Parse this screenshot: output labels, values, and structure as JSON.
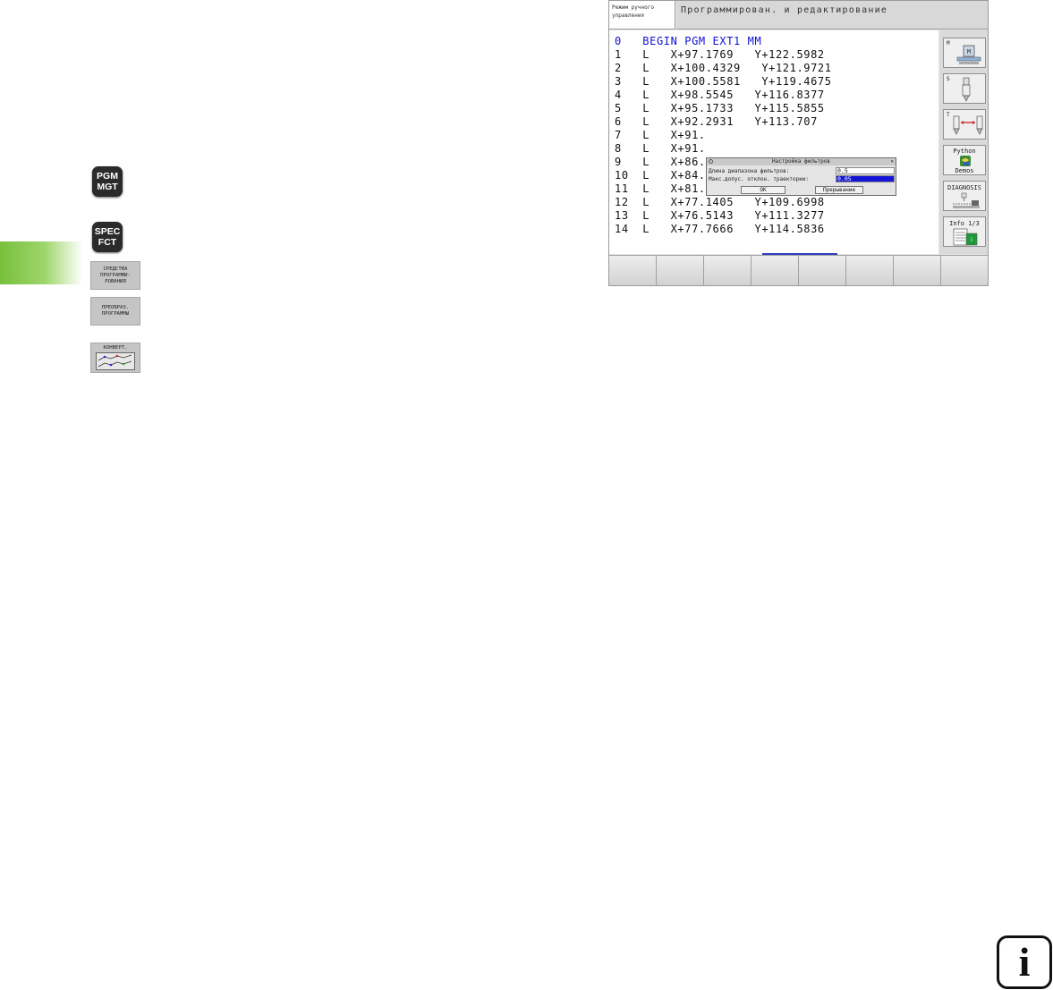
{
  "keys": {
    "pgm_mgt": [
      "PGM",
      "MGT"
    ],
    "spec_fct": [
      "SPEC",
      "FCT"
    ]
  },
  "softkeys": [
    {
      "lines": [
        "СРЕДСТВА",
        "ПРОГРАММИ-",
        "РОВАНИЯ"
      ]
    },
    {
      "lines": [
        "ПРЕОБРАЗ.",
        "ПРОГРАММЫ"
      ]
    },
    {
      "lines": [
        "КОНВЕРТ."
      ]
    }
  ],
  "header": {
    "mode_lines": [
      "Режим ручного",
      "управления"
    ],
    "title": "Программирован. и редактирование"
  },
  "program": [
    "0   BEGIN PGM EXT1 MM",
    "1   L   X+97.1769   Y+122.5982",
    "2   L   X+100.4329   Y+121.9721",
    "3   L   X+100.5581   Y+119.4675",
    "4   L   X+98.5545   Y+116.8377",
    "5   L   X+95.1733   Y+115.5855",
    "6   L   X+92.2931   Y+113.707",
    "7   L   X+91.",
    "8   L   X+91.",
    "9   L   X+86.",
    "10  L   X+84.5289   Y+111.7034",
    "11  L   X+81.0225   Y+110.2007",
    "12  L   X+77.1405   Y+109.6998",
    "13  L   X+76.5143   Y+111.3277",
    "14  L   X+77.7666   Y+114.5836"
  ],
  "dialog": {
    "title": "Настройка фильтров",
    "row1_label": "Длина диапазона фильтров:",
    "row1_value": "0.5",
    "row2_label": "Макс.допус. отклон. траектории:",
    "row2_value": "0.05",
    "ok": "OK",
    "cancel": "Прерывание"
  },
  "sidebar": {
    "m": "M",
    "s": "S",
    "t": "T",
    "python_top": "Python",
    "python_bottom": "Demos",
    "diagnosis": "DIAGNOSIS",
    "info": "Info 1/3"
  },
  "info_badge": "i"
}
